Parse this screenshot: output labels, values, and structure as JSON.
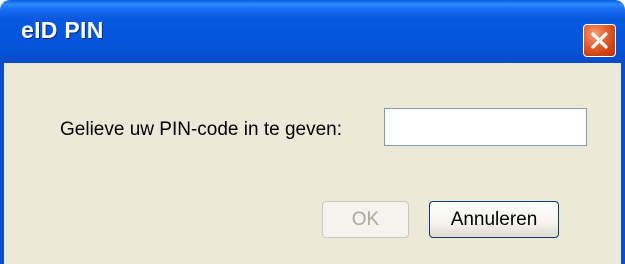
{
  "window": {
    "title": "eID PIN"
  },
  "dialog": {
    "prompt_label": "Gelieve uw PIN-code in te geven:",
    "pin_value": "",
    "ok_label": "OK",
    "ok_enabled": false,
    "cancel_label": "Annuleren"
  },
  "icons": {
    "close": "close-icon"
  },
  "colors": {
    "titlebar": "#0457dc",
    "close_button": "#e0582a",
    "client_background": "#ece9d8",
    "disabled_text": "#aca899"
  }
}
